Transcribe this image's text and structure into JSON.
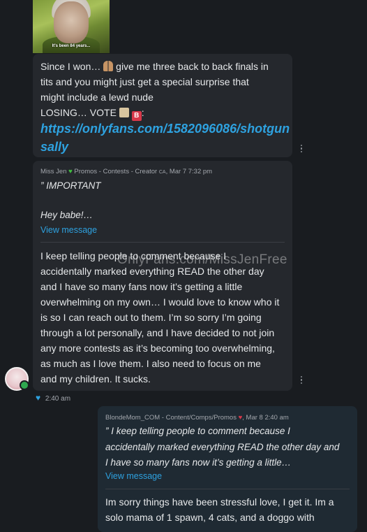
{
  "gif": {
    "caption": "It's been 84 years..."
  },
  "message1": {
    "line1_before": "Since I won… ",
    "line1_after": " give me three back to back finals in",
    "line2": "tits and you might just get a special surprise that",
    "line3": "might include a lewd nude",
    "line4_label": "LOSING… VOTE ",
    "line4_end": ":",
    "link_line1": "https://onlyfans.com/1582096086/shotgun",
    "link_line2": "sally"
  },
  "quoted_post": {
    "author": "Miss Jen",
    "meta_rest": " Promos - Contests - Creator",
    "country": "CA",
    "date": ", Mar 7 7:32 pm",
    "title": "” IMPORTANT",
    "body": "Hey babe!…",
    "view_label": "View message"
  },
  "message2": {
    "lines": [
      "I keep telling people to comment because I",
      "accidentally marked everything READ the other day",
      "and I have so many fans now it’s getting a little",
      "overwhelming on my own… I would love to know who it",
      "is so I can reach out to them. I’m so sorry I’m going",
      "through a lot personally, and I have decided to not join",
      "any more contests as it’s becoming too overwhelming,",
      "as much as I love them. I also need to focus on me",
      "and my children. It sucks."
    ]
  },
  "watermark": "OnlyFans.com/MissJenFree",
  "timestamp": "2:40 am",
  "reply": {
    "quoted_author": "BlondeMom_COM",
    "quoted_meta": " - Content/Comps/Promos ",
    "quoted_date": ", Mar 8 2:40 am",
    "quoted_lines": [
      "” I keep telling people to comment because I",
      "accidentally marked everything READ the other day and",
      "I have so many fans now it’s getting a little…"
    ],
    "view_label": "View message",
    "body_lines": [
      "Im sorry things have been stressful love, I get it. Im a",
      "solo mama of 1 spawn, 4 cats, and a doggo with"
    ]
  },
  "colors": {
    "link": "#2ea2e0",
    "heart_green": "#3fbf3f",
    "heart_blue": "#2ea2e0",
    "heart_red": "#d8384a",
    "online": "#2fa84f"
  }
}
